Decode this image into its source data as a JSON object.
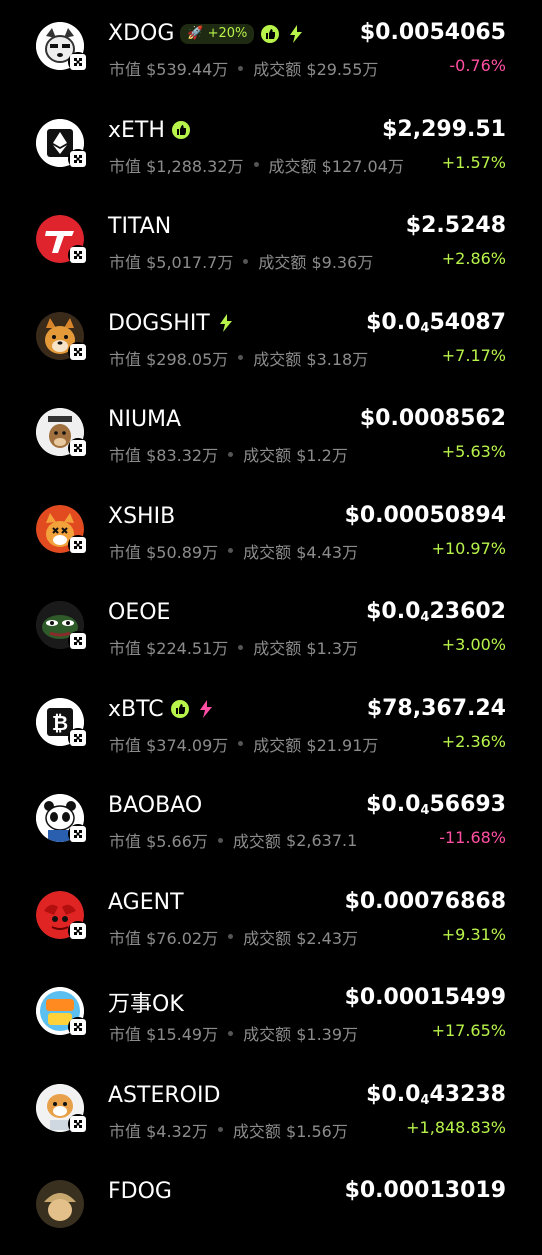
{
  "colors": {
    "up": "#b7f34b",
    "down": "#ff4fa2",
    "muted": "#8c8c8c",
    "background": "#000000"
  },
  "labels": {
    "market_cap": "市值",
    "volume": "成交额"
  },
  "tokens": [
    {
      "name": "XDOG",
      "boost": "+20%",
      "badges": [
        "thumb-icon",
        "lightning-icon"
      ],
      "market_cap": "$539.44万",
      "volume": "$29.55万",
      "price": "$0.0054065",
      "change": "-0.76%",
      "dir": "down",
      "avatar": "dog"
    },
    {
      "name": "xETH",
      "badges": [
        "thumb-icon"
      ],
      "market_cap": "$1,288.32万",
      "volume": "$127.04万",
      "price": "$2,299.51",
      "change": "+1.57%",
      "dir": "up",
      "avatar": "eth"
    },
    {
      "name": "TITAN",
      "badges": [],
      "market_cap": "$5,017.7万",
      "volume": "$9.36万",
      "price": "$2.5248",
      "change": "+2.86%",
      "dir": "up",
      "avatar": "titan"
    },
    {
      "name": "DOGSHIT",
      "badges": [
        "lightning-icon"
      ],
      "market_cap": "$298.05万",
      "volume": "$3.18万",
      "price_main": "$0.0",
      "price_sub": "4",
      "price_tail": "54087",
      "change": "+7.17%",
      "dir": "up",
      "avatar": "shiba"
    },
    {
      "name": "NIUMA",
      "badges": [],
      "market_cap": "$83.32万",
      "volume": "$1.2万",
      "price": "$0.0008562",
      "change": "+5.63%",
      "dir": "up",
      "avatar": "niuma"
    },
    {
      "name": "XSHIB",
      "badges": [],
      "market_cap": "$50.89万",
      "volume": "$4.43万",
      "price": "$0.00050894",
      "change": "+10.97%",
      "dir": "up",
      "avatar": "xshib"
    },
    {
      "name": "OEOE",
      "badges": [],
      "market_cap": "$224.51万",
      "volume": "$1.3万",
      "price_main": "$0.0",
      "price_sub": "4",
      "price_tail": "23602",
      "change": "+3.00%",
      "dir": "up",
      "avatar": "pepe"
    },
    {
      "name": "xBTC",
      "badges": [
        "thumb-icon",
        "lightning-pink-icon"
      ],
      "market_cap": "$374.09万",
      "volume": "$21.91万",
      "price": "$78,367.24",
      "change": "+2.36%",
      "dir": "up",
      "avatar": "btc"
    },
    {
      "name": "BAOBAO",
      "badges": [],
      "market_cap": "$5.66万",
      "volume": "$2,637.1",
      "price_main": "$0.0",
      "price_sub": "4",
      "price_tail": "56693",
      "change": "-11.68%",
      "dir": "down",
      "avatar": "panda"
    },
    {
      "name": "AGENT",
      "badges": [],
      "market_cap": "$76.02万",
      "volume": "$2.43万",
      "price": "$0.00076868",
      "change": "+9.31%",
      "dir": "up",
      "avatar": "agent"
    },
    {
      "name": "万事OK",
      "badges": [],
      "market_cap": "$15.49万",
      "volume": "$1.39万",
      "price": "$0.00015499",
      "change": "+17.65%",
      "dir": "up",
      "avatar": "ok"
    },
    {
      "name": "ASTEROID",
      "badges": [],
      "market_cap": "$4.32万",
      "volume": "$1.56万",
      "price_main": "$0.0",
      "price_sub": "4",
      "price_tail": "43238",
      "change": "+1,848.83%",
      "dir": "up",
      "avatar": "astro"
    },
    {
      "name": "FDOG",
      "badges": [],
      "market_cap": "",
      "volume": "",
      "price": "$0.00013019",
      "change": "",
      "dir": "up",
      "avatar": "fdog"
    }
  ]
}
